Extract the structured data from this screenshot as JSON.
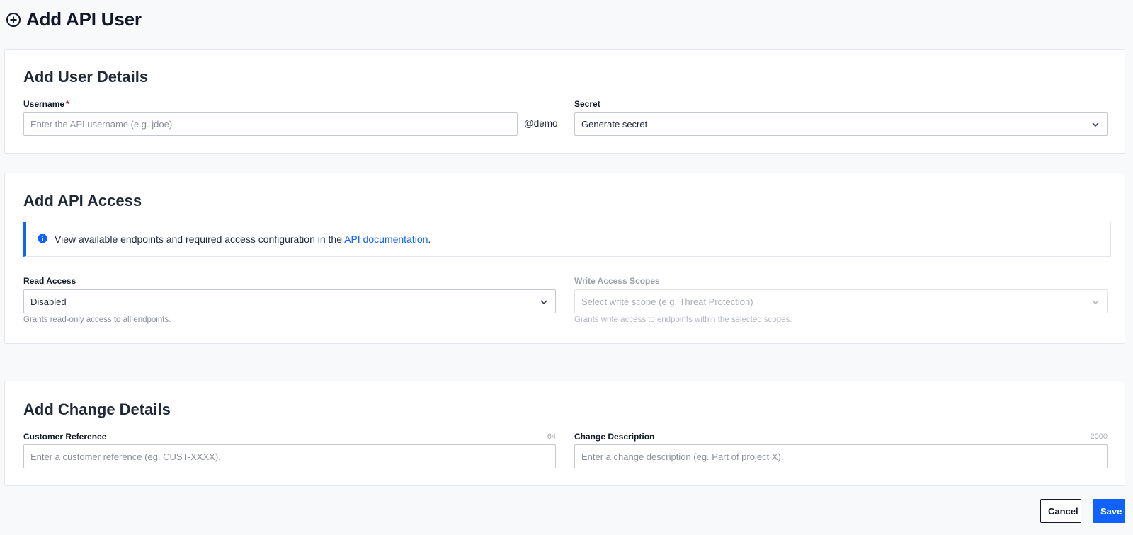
{
  "page": {
    "title": "Add API User"
  },
  "user_details": {
    "title": "Add User Details",
    "username_label": "Username",
    "username_required": "*",
    "username_placeholder": "Enter the API username (e.g. jdoe)",
    "username_value": "",
    "username_suffix": "@demo",
    "secret_label": "Secret",
    "secret_value": "Generate secret"
  },
  "api_access": {
    "title": "Add API Access",
    "info_text": "View available endpoints and required access configuration in the ",
    "info_link": "API documentation",
    "info_after": ".",
    "read_label": "Read Access",
    "read_value": "Disabled",
    "read_helper": "Grants read-only access to all endpoints.",
    "write_label": "Write Access Scopes",
    "write_placeholder": "Select write scope (e.g. Threat Protection)",
    "write_helper": "Grants write access to endpoints within the selected scopes."
  },
  "change_details": {
    "title": "Add Change Details",
    "customer_ref_label": "Customer Reference",
    "customer_ref_max": "64",
    "customer_ref_placeholder": "Enter a customer reference (eg. CUST-XXXX).",
    "change_desc_label": "Change Description",
    "change_desc_max": "2000",
    "change_desc_placeholder": "Enter a change description (eg. Part of project X)."
  },
  "actions": {
    "cancel": "Cancel",
    "save": "Save"
  },
  "colors": {
    "accent": "#0f62fe",
    "required": "#c62828",
    "background": "#f8f9fb"
  },
  "icons": {
    "title_icon": "plus-circle-icon",
    "info_icon": "info-icon",
    "select_icon": "chevron-down-icon"
  }
}
